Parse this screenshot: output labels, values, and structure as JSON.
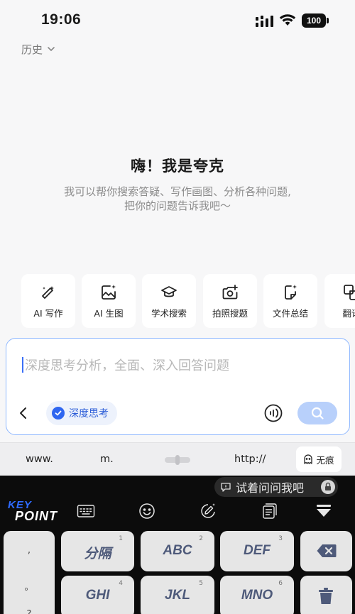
{
  "status_bar": {
    "time": "19:06",
    "battery": "100"
  },
  "history": {
    "label": "历史"
  },
  "greeting": {
    "title": "嗨！我是夸克",
    "line1": "我可以帮你搜索答疑、写作画图、分析各种问题,",
    "line2": "把你的问题告诉我吧～"
  },
  "tools": [
    {
      "label": "AI 写作",
      "icon": "magic-pen-icon"
    },
    {
      "label": "AI 生图",
      "icon": "image-sparkle-icon"
    },
    {
      "label": "学术搜索",
      "icon": "graduation-cap-icon"
    },
    {
      "label": "拍照搜题",
      "icon": "camera-plus-icon"
    },
    {
      "label": "文件总结",
      "icon": "file-sparkle-icon"
    },
    {
      "label": "翻译",
      "icon": "translate-icon"
    }
  ],
  "input": {
    "placeholder": "深度思考分析，全面、深入回答问题",
    "deep_think_label": "深度思考"
  },
  "url_bar": {
    "www": "www.",
    "m": "m.",
    "http": "http://",
    "incognito": "无痕"
  },
  "keyboard": {
    "try_label": "试着问问我吧",
    "brand_top": "KEY",
    "brand_bottom": "POINT",
    "punct": [
      ",",
      "。",
      "?"
    ],
    "keys": [
      {
        "main": "分隔",
        "num": "1"
      },
      {
        "main": "ABC",
        "num": "2"
      },
      {
        "main": "DEF",
        "num": "3"
      },
      {
        "main": "GHI",
        "num": "4"
      },
      {
        "main": "JKL",
        "num": "5"
      },
      {
        "main": "MNO",
        "num": "6"
      }
    ]
  },
  "colors": {
    "accent": "#2f66f0",
    "input_border": "#8fb8ff",
    "send_button": "#b8d0fb",
    "keyboard_bg": "#0c0c0c",
    "key_bg": "#e6e6e6"
  }
}
